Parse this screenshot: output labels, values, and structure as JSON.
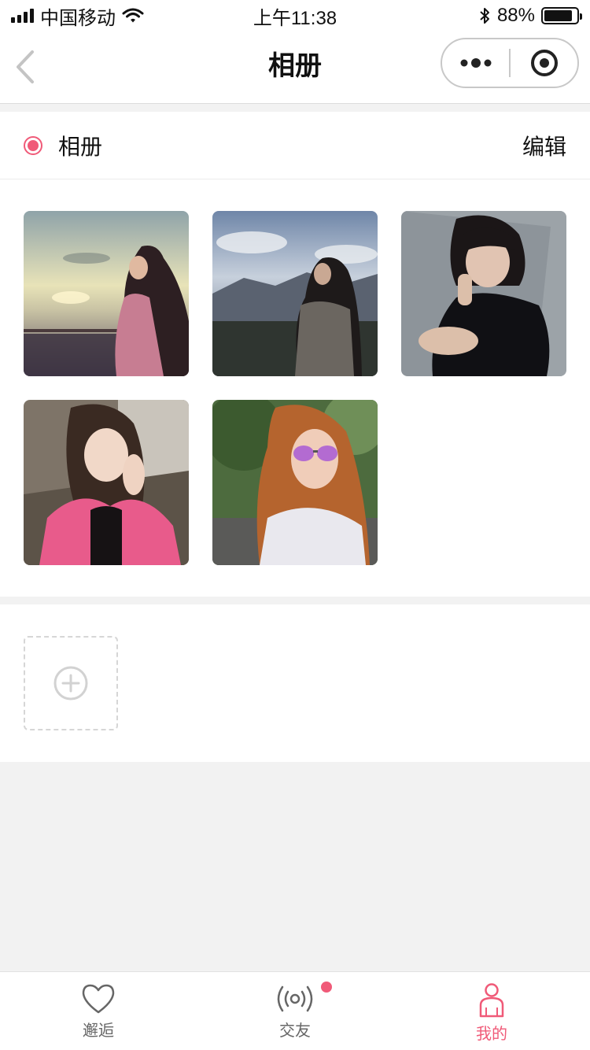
{
  "status_bar": {
    "carrier": "中国移动",
    "time": "上午11:38",
    "battery": "88%",
    "battery_level": 0.88
  },
  "nav": {
    "title": "相册",
    "back_icon": "chevron-left-icon",
    "more_icon": "more-dots-icon",
    "close_icon": "target-circle-icon"
  },
  "album": {
    "label": "相册",
    "edit_label": "编辑",
    "accent_color": "#f05a78"
  },
  "photos": [
    {
      "name": "photo-woman-sunset-sea"
    },
    {
      "name": "photo-woman-mountain-view"
    },
    {
      "name": "photo-girl-black-outfit"
    },
    {
      "name": "photo-girl-pink-jacket"
    },
    {
      "name": "photo-girl-sunglasses"
    }
  ],
  "add_tile": {
    "icon": "plus-circle-icon"
  },
  "tabbar": {
    "active_color": "#f05a78",
    "items": [
      {
        "label": "邂逅",
        "icon": "heart-icon",
        "active": false
      },
      {
        "label": "交友",
        "icon": "broadcast-icon",
        "active": false,
        "badge": true
      },
      {
        "label": "我的",
        "icon": "user-icon",
        "active": true
      }
    ]
  }
}
